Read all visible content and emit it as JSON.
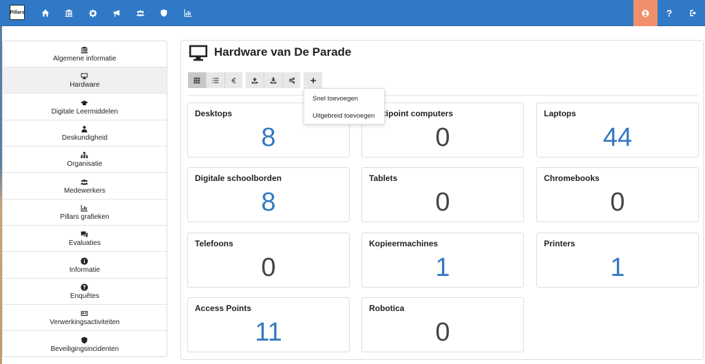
{
  "nav": {
    "logo_text": "Pillars",
    "icons": [
      "home-icon",
      "institution-icon",
      "gear-icon",
      "megaphone-icon",
      "users-icon",
      "shield-icon",
      "bar-chart-icon"
    ],
    "help_label": "?",
    "accent": "#2f79c6",
    "user_color": "#ef8f6b"
  },
  "sidebar": {
    "items": [
      {
        "label": "Algemene informatie",
        "icon": "institution-icon"
      },
      {
        "label": "Hardware",
        "icon": "monitor-icon"
      },
      {
        "label": "Digitale Leermiddelen",
        "icon": "graduation-cap-icon"
      },
      {
        "label": "Deskundigheid",
        "icon": "user-tie-icon"
      },
      {
        "label": "Organisatie",
        "icon": "sitemap-icon"
      },
      {
        "label": "Medewerkers",
        "icon": "users-icon"
      },
      {
        "label": "Pillars grafieken",
        "icon": "bar-chart-icon"
      },
      {
        "label": "Evaluaties",
        "icon": "comments-icon"
      },
      {
        "label": "Informatie",
        "icon": "info-icon"
      },
      {
        "label": "Enquêtes",
        "icon": "question-icon"
      },
      {
        "label": "Verwerkingsactiviteiten",
        "icon": "id-card-icon"
      },
      {
        "label": "Beveiligingsincidenten",
        "icon": "shield-icon"
      }
    ]
  },
  "main": {
    "title": "Hardware van De Parade",
    "toolbar": [
      "grid-icon",
      "list-icon",
      "euro-icon",
      "upload-icon",
      "download-icon",
      "gears-icon",
      "plus-icon"
    ],
    "dropdown": [
      "Snel toevoegen",
      "Uitgebreid toevoegen"
    ],
    "cards": [
      {
        "title": "Desktops",
        "value": "8",
        "color": "blue"
      },
      {
        "title": "Multipoint computers",
        "value": "0",
        "color": "grey"
      },
      {
        "title": "Laptops",
        "value": "44",
        "color": "blue"
      },
      {
        "title": "Digitale schoolborden",
        "value": "8",
        "color": "blue"
      },
      {
        "title": "Tablets",
        "value": "0",
        "color": "grey"
      },
      {
        "title": "Chromebooks",
        "value": "0",
        "color": "grey"
      },
      {
        "title": "Telefoons",
        "value": "0",
        "color": "grey"
      },
      {
        "title": "Kopieermachines",
        "value": "1",
        "color": "blue"
      },
      {
        "title": "Printers",
        "value": "1",
        "color": "blue"
      },
      {
        "title": "Access Points",
        "value": "11",
        "color": "blue"
      },
      {
        "title": "Robotica",
        "value": "0",
        "color": "grey"
      }
    ]
  }
}
